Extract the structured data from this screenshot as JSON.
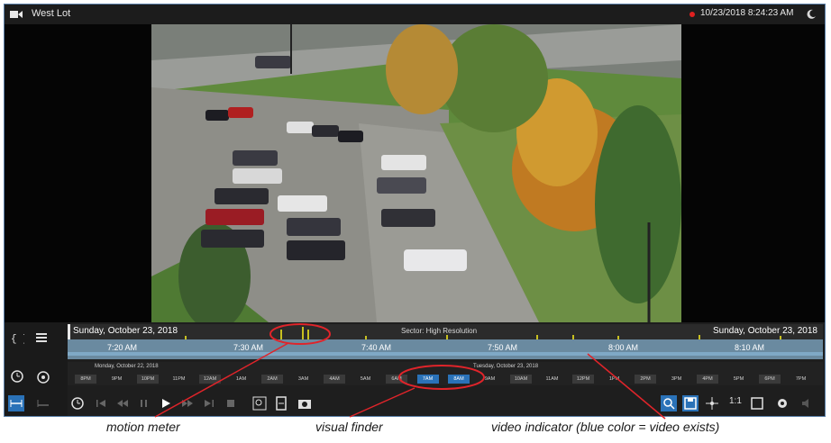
{
  "window": {
    "camera_name": "West Lot",
    "datetime": "10/23/2018 8:24:23 AM"
  },
  "timeline": {
    "date_left": "Sunday, October 23, 2018",
    "date_right": "Sunday, October 23, 2018",
    "sector": "Sector: High Resolution",
    "time_labels": [
      "7:20 AM",
      "7:30 AM",
      "7:40 AM",
      "7:50 AM",
      "8:00 AM",
      "8:10 AM"
    ]
  },
  "visual_finder": {
    "date_left": "Monday, October 22, 2018",
    "date_right": "Tuesday, October 23, 2018",
    "hours": [
      "8PM",
      "9PM",
      "10PM",
      "11PM",
      "12AM",
      "1AM",
      "2AM",
      "3AM",
      "4AM",
      "5AM",
      "6AM",
      "7AM",
      "8AM",
      "9AM",
      "10AM",
      "11AM",
      "12PM",
      "1PM",
      "2PM",
      "3PM",
      "4PM",
      "5PM",
      "6PM",
      "7PM"
    ],
    "highlighted_hours": [
      "7AM",
      "8AM"
    ]
  },
  "toolbar": {
    "ratio_label": "1:1"
  },
  "annotations": {
    "motion_meter": "motion meter",
    "visual_finder": "visual finder",
    "video_indicator": "video indicator (blue color = video exists)"
  },
  "colors": {
    "accent": "#2a72b8",
    "record": "#e02020",
    "motion": "#c8c020",
    "annotation_ring": "#e0242a"
  }
}
